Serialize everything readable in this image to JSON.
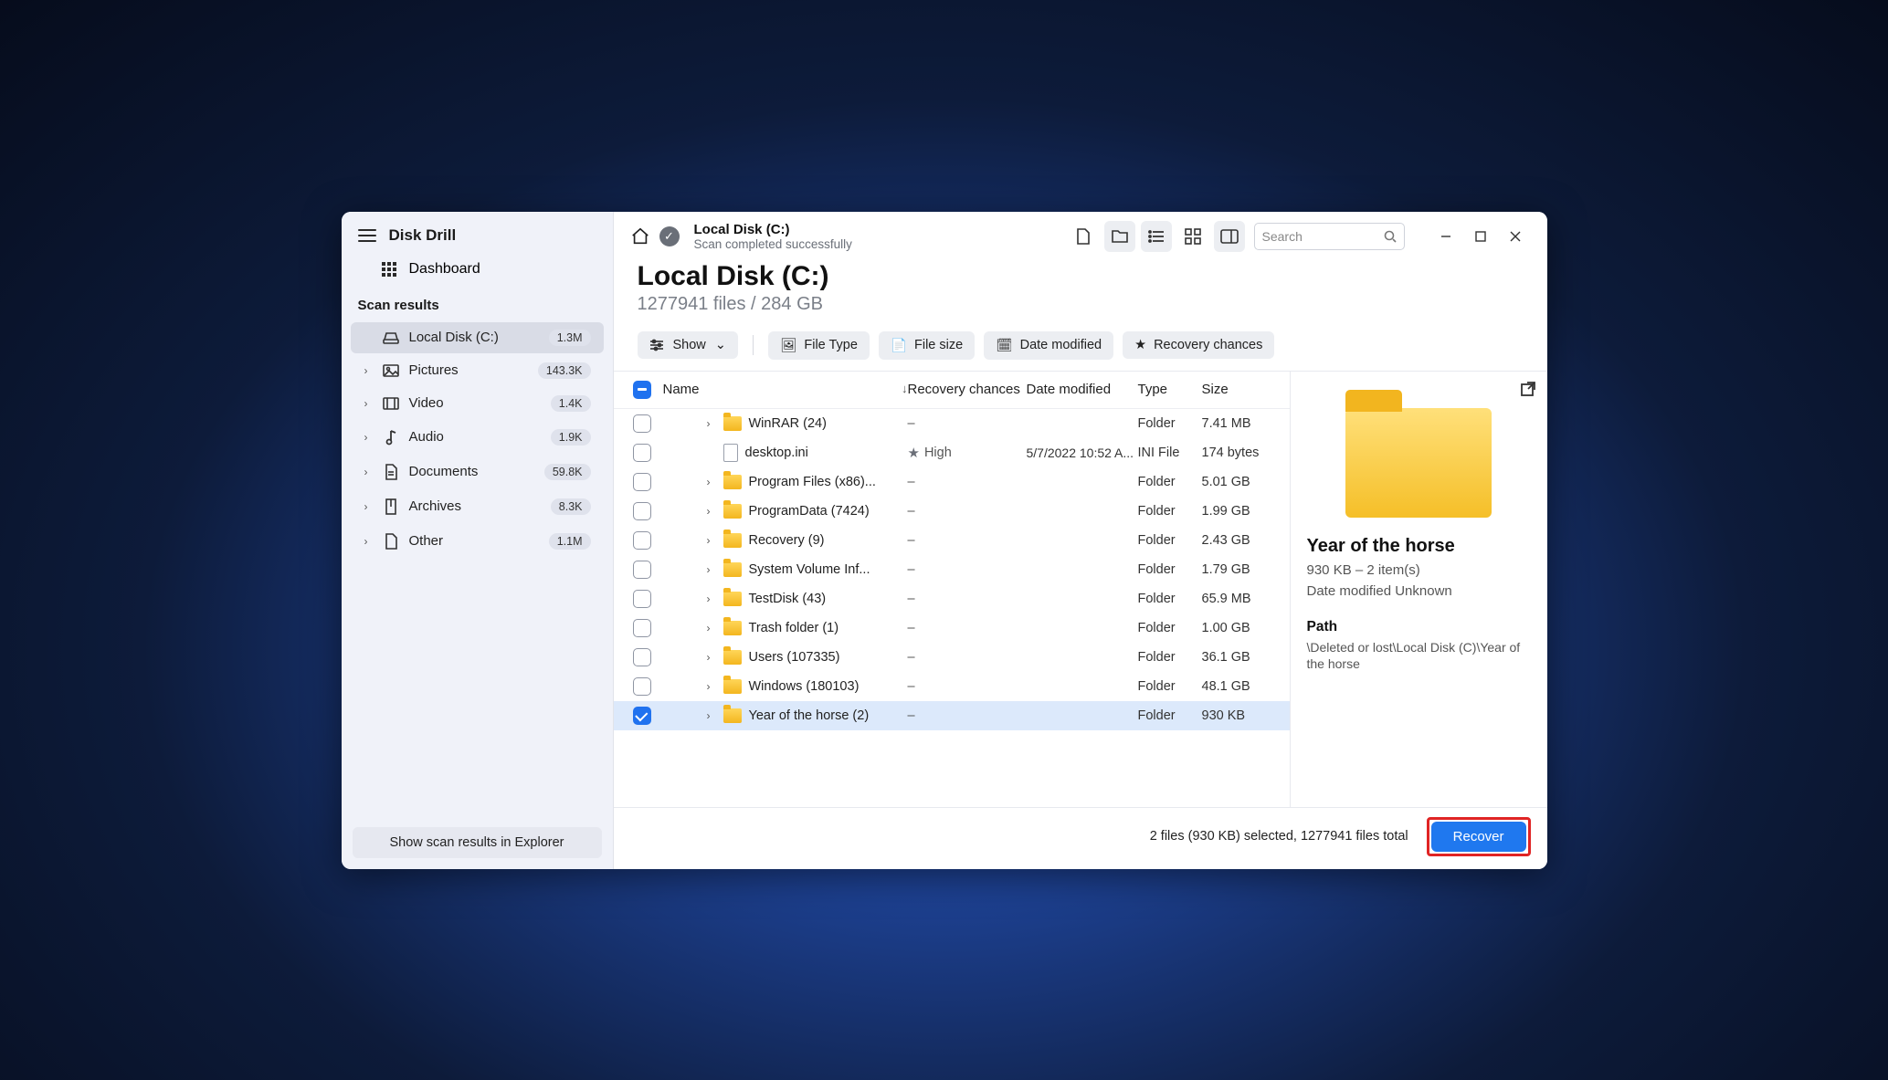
{
  "app": {
    "title": "Disk Drill"
  },
  "sidebar": {
    "dashboard": "Dashboard",
    "section": "Scan results",
    "items": [
      {
        "label": "Local Disk (C:)",
        "badge": "1.3M",
        "icon": "disk",
        "selected": true,
        "expandable": false
      },
      {
        "label": "Pictures",
        "badge": "143.3K",
        "icon": "image",
        "selected": false,
        "expandable": true
      },
      {
        "label": "Video",
        "badge": "1.4K",
        "icon": "video",
        "selected": false,
        "expandable": true
      },
      {
        "label": "Audio",
        "badge": "1.9K",
        "icon": "audio",
        "selected": false,
        "expandable": true
      },
      {
        "label": "Documents",
        "badge": "59.8K",
        "icon": "doc",
        "selected": false,
        "expandable": true
      },
      {
        "label": "Archives",
        "badge": "8.3K",
        "icon": "archive",
        "selected": false,
        "expandable": true
      },
      {
        "label": "Other",
        "badge": "1.1M",
        "icon": "other",
        "selected": false,
        "expandable": true
      }
    ],
    "footer_button": "Show scan results in Explorer"
  },
  "topbar": {
    "title": "Local Disk (C:)",
    "subtitle": "Scan completed successfully",
    "search_placeholder": "Search"
  },
  "heading": {
    "title": "Local Disk (C:)",
    "subtitle": "1277941 files / 284 GB"
  },
  "filters": {
    "show": "Show",
    "file_type": "File Type",
    "file_size": "File size",
    "date_modified": "Date modified",
    "recovery": "Recovery chances"
  },
  "columns": {
    "name": "Name",
    "recovery": "Recovery chances",
    "date": "Date modified",
    "type": "Type",
    "size": "Size"
  },
  "rows": [
    {
      "expandable": true,
      "kind": "folder",
      "name": "WinRAR (24)",
      "recovery": "–",
      "date": "",
      "type": "Folder",
      "size": "7.41 MB",
      "checked": false
    },
    {
      "expandable": false,
      "kind": "file",
      "name": "desktop.ini",
      "recovery": "High",
      "date": "5/7/2022 10:52 A...",
      "type": "INI File",
      "size": "174 bytes",
      "checked": false
    },
    {
      "expandable": true,
      "kind": "folder",
      "name": "Program Files (x86)...",
      "recovery": "–",
      "date": "",
      "type": "Folder",
      "size": "5.01 GB",
      "checked": false
    },
    {
      "expandable": true,
      "kind": "folder",
      "name": "ProgramData (7424)",
      "recovery": "–",
      "date": "",
      "type": "Folder",
      "size": "1.99 GB",
      "checked": false
    },
    {
      "expandable": true,
      "kind": "folder",
      "name": "Recovery (9)",
      "recovery": "–",
      "date": "",
      "type": "Folder",
      "size": "2.43 GB",
      "checked": false
    },
    {
      "expandable": true,
      "kind": "folder",
      "name": "System Volume Inf...",
      "recovery": "–",
      "date": "",
      "type": "Folder",
      "size": "1.79 GB",
      "checked": false
    },
    {
      "expandable": true,
      "kind": "folder",
      "name": "TestDisk (43)",
      "recovery": "–",
      "date": "",
      "type": "Folder",
      "size": "65.9 MB",
      "checked": false
    },
    {
      "expandable": true,
      "kind": "folder",
      "name": "Trash folder (1)",
      "recovery": "–",
      "date": "",
      "type": "Folder",
      "size": "1.00 GB",
      "checked": false
    },
    {
      "expandable": true,
      "kind": "folder",
      "name": "Users (107335)",
      "recovery": "–",
      "date": "",
      "type": "Folder",
      "size": "36.1 GB",
      "checked": false
    },
    {
      "expandable": true,
      "kind": "folder",
      "name": "Windows (180103)",
      "recovery": "–",
      "date": "",
      "type": "Folder",
      "size": "48.1 GB",
      "checked": false
    },
    {
      "expandable": true,
      "kind": "folder",
      "name": "Year of the horse (2)",
      "recovery": "–",
      "date": "",
      "type": "Folder",
      "size": "930 KB",
      "checked": true
    }
  ],
  "detail": {
    "title": "Year of the horse",
    "meta": "930 KB – 2 item(s)",
    "date_line": "Date modified Unknown",
    "path_label": "Path",
    "path": "\\Deleted or lost\\Local Disk (C)\\Year of the horse"
  },
  "footer": {
    "status": "2 files (930 KB) selected, 1277941 files total",
    "recover": "Recover"
  }
}
